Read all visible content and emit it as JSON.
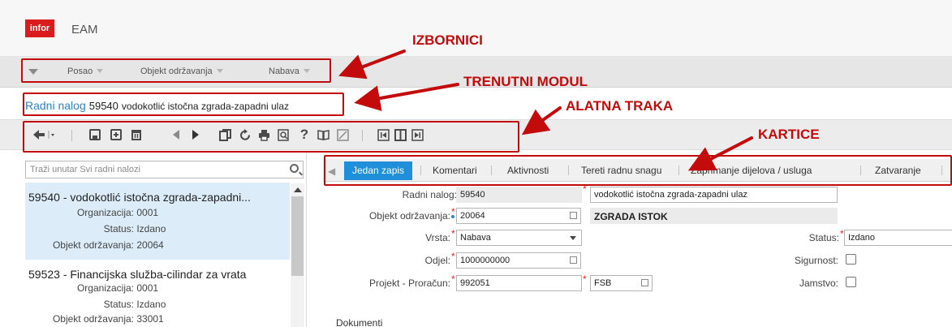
{
  "header": {
    "logo_text": "infor",
    "app_title": "EAM"
  },
  "menu": {
    "items": [
      {
        "label": "Posao"
      },
      {
        "label": "Objekt održavanja"
      },
      {
        "label": "Nabava"
      }
    ]
  },
  "record": {
    "module": "Radni nalog",
    "number": "59540",
    "description": "vodokotlić istočna zgrada-zapadni ulaz"
  },
  "sidebar": {
    "search_placeholder": "Traži unutar Svi radni nalozi",
    "records": [
      {
        "title": "59540 - vodokotlić istočna zgrada-zapadni...",
        "org_label": "Organizacija:",
        "org": "0001",
        "status_label": "Status:",
        "status": "Izdano",
        "obj_label": "Objekt održavanja:",
        "obj": "20064"
      },
      {
        "title": "59523 - Financijska služba-cilindar za vrata",
        "org_label": "Organizacija:",
        "org": "0001",
        "status_label": "Status:",
        "status": "Izdano",
        "obj_label": "Objekt održavanja:",
        "obj": "33001"
      }
    ]
  },
  "tabs": [
    {
      "label": "Jedan zapis"
    },
    {
      "label": "Komentari"
    },
    {
      "label": "Aktivnosti"
    },
    {
      "label": "Tereti radnu snagu"
    },
    {
      "label": "Zaprimanje dijelova / usluga"
    },
    {
      "label": "Zatvaranje"
    }
  ],
  "form": {
    "radni_nalog_label": "Radni nalog:",
    "radni_nalog_value": "59540",
    "description_value": "vodokotlić istočna zgrada-zapadni ulaz",
    "objekt_label": "Objekt održavanja:",
    "objekt_value": "20064",
    "objekt_desc": "ZGRADA ISTOK",
    "vrsta_label": "Vrsta:",
    "vrsta_value": "Nabava",
    "status_label": "Status:",
    "status_value": "Izdano",
    "odjel_label": "Odjel:",
    "odjel_value": "1000000000",
    "sigurnost_label": "Sigurnost:",
    "projekt_label": "Projekt - Proračun:",
    "projekt_value": "992051",
    "proracun_value": "FSB",
    "jamstvo_label": "Jamstvo:",
    "dokumenti_label": "Dokumenti"
  },
  "annotations": {
    "izbornici": "IZBORNICI",
    "trenutni_modul": "TRENUTNI MODUL",
    "alatna_traka": "ALATNA TRAKA",
    "kartice": "KARTICE",
    "color": "#c40b0b"
  }
}
